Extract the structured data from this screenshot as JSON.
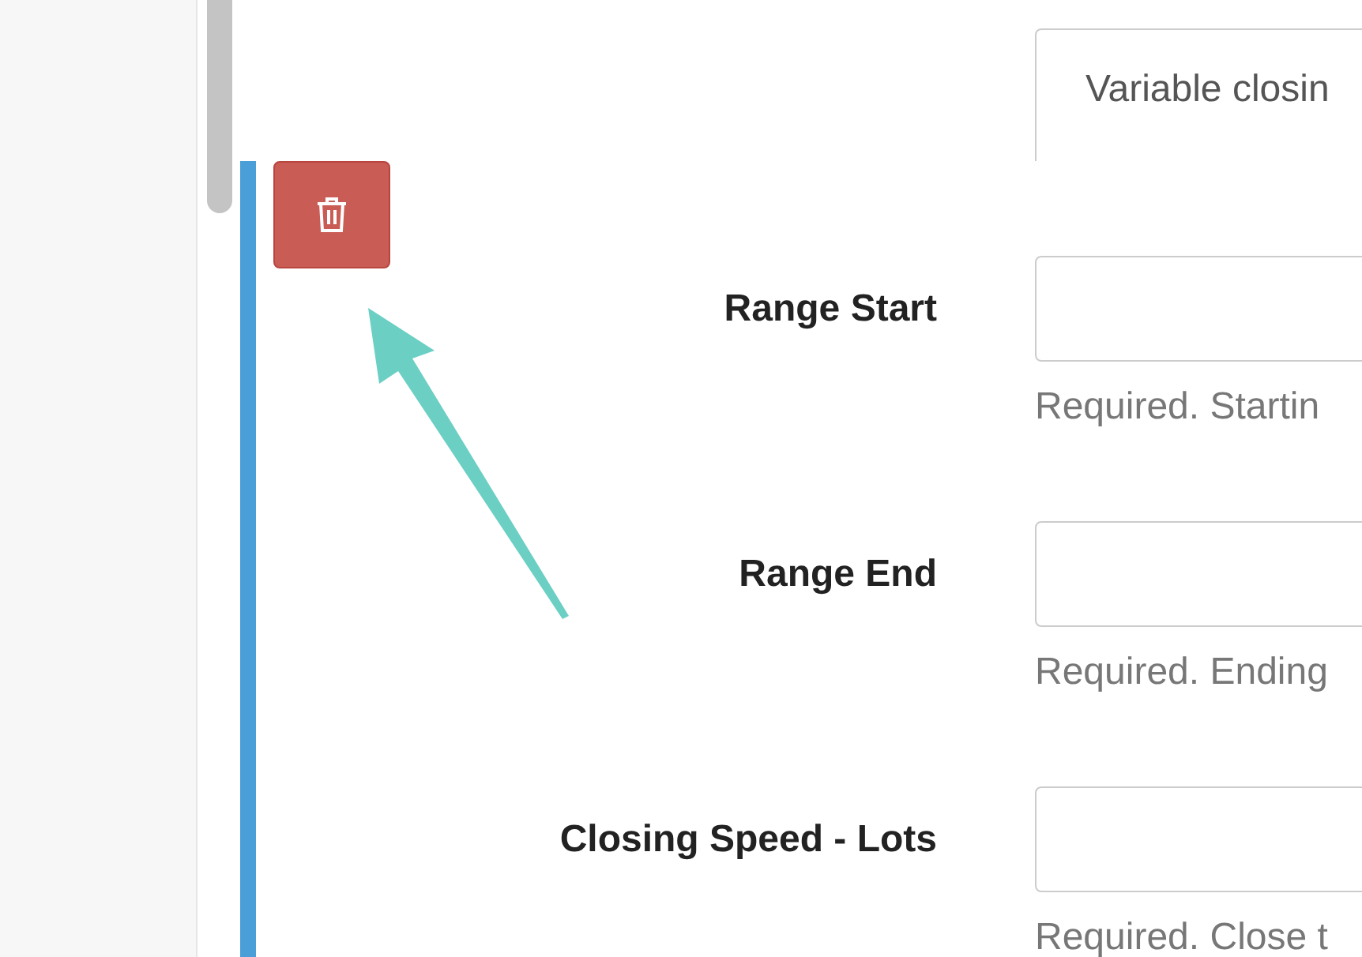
{
  "top_field": {
    "value": "Variable closin"
  },
  "rows": [
    {
      "label": "Range Start",
      "help": "Required. Startin"
    },
    {
      "label": "Range End",
      "help": "Required. Ending"
    },
    {
      "label": "Closing Speed - Lots",
      "help": "Required. Close t"
    }
  ]
}
